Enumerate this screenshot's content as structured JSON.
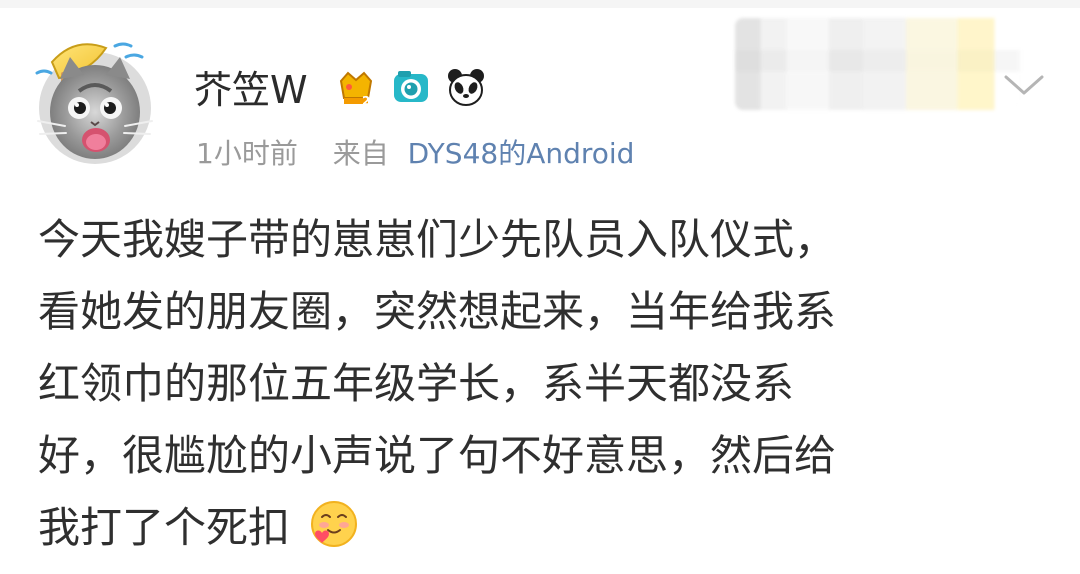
{
  "post": {
    "username": "芥笠W",
    "timestamp": "1小时前",
    "source_prefix": "来自",
    "source": "DYS48的Android",
    "text_lines": [
      "今天我嫂子带的崽崽们少先队员入队仪式，",
      "看她发的朋友圈，突然想起来，当年给我系",
      "红领巾的那位五年级学长，系半天都没系",
      "好，很尴尬的小声说了句不好意思，然后给",
      "我打了个死扣"
    ]
  },
  "badges": [
    "membership-crown-icon",
    "camera-icon",
    "panda-icon"
  ],
  "icons": {
    "avatar": "cat-avatar-icon",
    "menu": "chevron-down-icon",
    "emoji": "blush-heart-emoji-icon"
  },
  "colors": {
    "name": "#2b2b2b",
    "meta": "#9a9a9a",
    "source": "#5f82b0",
    "body_text": "#2f2f2f",
    "badge_gold": "#f4b400",
    "badge_teal": "#27b8c8"
  }
}
